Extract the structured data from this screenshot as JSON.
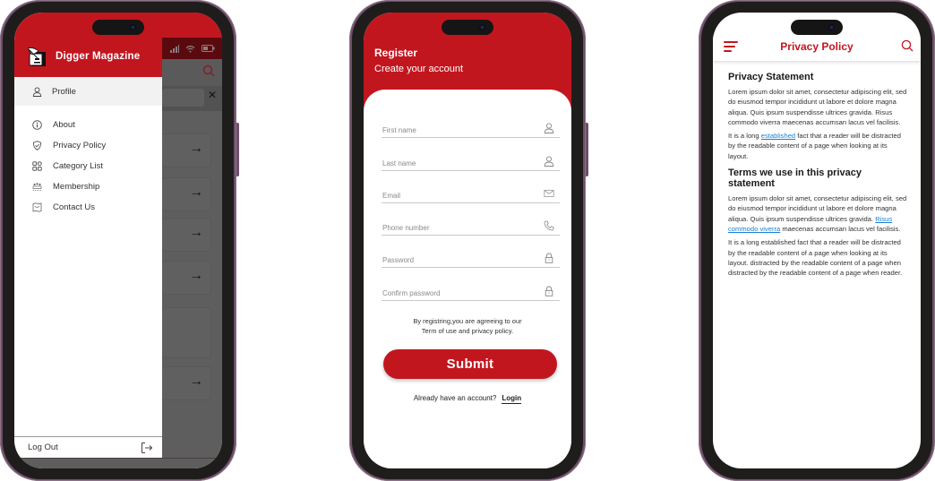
{
  "colors": {
    "brand_red": "#c2161f",
    "link_blue": "#1a7fd4",
    "phone_frame": "#6d4e68",
    "overlay_grey": "#5e5e5e"
  },
  "drawer_screen": {
    "app_name": "Digger Magazine",
    "logo_icon": "quill-pen-logo",
    "profile": {
      "label": "Profile",
      "icon": "user-icon"
    },
    "items": [
      {
        "label": "About",
        "icon": "info-icon"
      },
      {
        "label": "Privacy Policy",
        "icon": "shield-check-icon"
      },
      {
        "label": "Category List",
        "icon": "grid-icon"
      },
      {
        "label": "Membership",
        "icon": "group-icon"
      },
      {
        "label": "Contact Us",
        "icon": "map-icon"
      }
    ],
    "logout": {
      "label": "Log Out",
      "icon": "logout-icon"
    },
    "background": {
      "status_icons": [
        "signal-icon",
        "wifi-icon",
        "battery-icon"
      ],
      "search_icon": "search-icon",
      "clear_icon": "✕",
      "card_arrow": "→"
    }
  },
  "register_screen": {
    "title": "Register",
    "subtitle": "Create your account",
    "fields": [
      {
        "placeholder": "First name",
        "value": "",
        "icon": "user-icon"
      },
      {
        "placeholder": "Last name",
        "value": "",
        "icon": "user-icon"
      },
      {
        "placeholder": "Email",
        "value": "",
        "icon": "mail-icon"
      },
      {
        "placeholder": "Phone number",
        "value": "",
        "icon": "phone-icon"
      },
      {
        "placeholder": "Password",
        "value": "",
        "icon": "lock-icon"
      },
      {
        "placeholder": "Confirm password",
        "value": "",
        "icon": "lock-icon"
      }
    ],
    "terms_line1": "By registring,you are agreeing to our",
    "terms_line2": "Term of use  and privacy policy.",
    "submit_label": "Submit",
    "login_prompt": "Already have an account?",
    "login_label": "Login"
  },
  "privacy_screen": {
    "title": "Privacy Policy",
    "menu_icon": "hamburger-icon",
    "search_icon": "search-icon",
    "section1": {
      "heading": "Privacy Statement",
      "para1": "Lorem ipsum dolor sit amet, consectetur adipiscing elit, sed do eiusmod tempor incididunt ut labore et dolore magna aliqua. Quis ipsum suspendisse ultrices gravida. Risus commodo viverra maecenas accumsan lacus vel facilisis.",
      "para2_before": "It is a long ",
      "para2_link": "established",
      "para2_after": " fact that a reader will be distracted by the readable content of a page when looking at its layout."
    },
    "section2": {
      "heading": "Terms we use in this privacy statement",
      "para1_before": "Lorem ipsum dolor sit amet, consectetur adipiscing elit, sed do eiusmod tempor incididunt ut labore et dolore magna aliqua. Quis ipsum suspendisse ultrices gravida. ",
      "para1_link": "Risus commodo viverra",
      "para1_after": " maecenas accumsan lacus vel facilisis.",
      "para2": "It is a long established fact that a reader will be distracted by the readable content of a page when looking at its layout. distracted by the readable content of a page when distracted by the readable content of a page when reader."
    }
  }
}
